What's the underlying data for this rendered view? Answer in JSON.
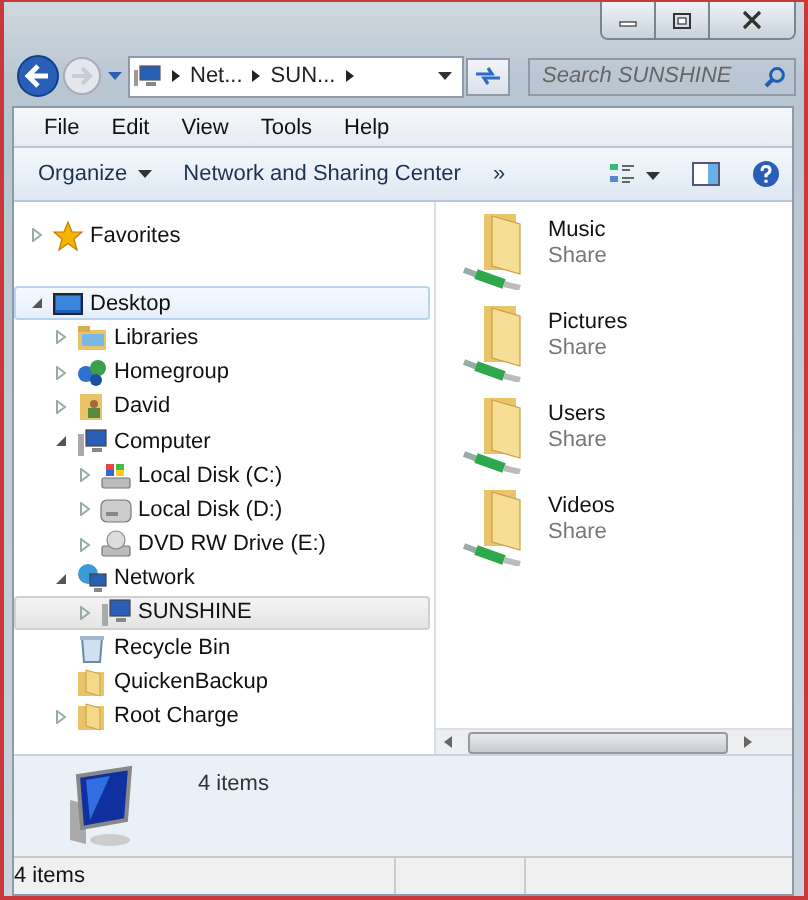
{
  "address": {
    "crumbs": [
      "Net...",
      "SUN..."
    ]
  },
  "search": {
    "placeholder": "Search SUNSHINE"
  },
  "menu": [
    "File",
    "Edit",
    "View",
    "Tools",
    "Help"
  ],
  "commands": [
    {
      "label": "Organize",
      "kind": "dropdown"
    },
    {
      "label": "Network and Sharing Center",
      "kind": "plain"
    },
    {
      "label": "»",
      "kind": "plain"
    }
  ],
  "tree": [
    {
      "label": "Favorites",
      "kind": "star",
      "expanded": false,
      "selected": false,
      "hovered": false
    },
    {
      "label": "Desktop",
      "kind": "desktop",
      "expanded": true,
      "selected": false,
      "hovered": true,
      "children": [
        {
          "label": "Libraries",
          "kind": "library",
          "expanded": false,
          "selected": false,
          "hovered": false
        },
        {
          "label": "Homegroup",
          "kind": "homegroup",
          "expanded": false,
          "selected": false,
          "hovered": false
        },
        {
          "label": "David",
          "kind": "user",
          "expanded": false,
          "selected": false,
          "hovered": false
        },
        {
          "label": "Computer",
          "kind": "computer",
          "expanded": true,
          "selected": false,
          "hovered": false,
          "children": [
            {
              "label": "Local Disk (C:)",
              "kind": "sysdisk",
              "expanded": false,
              "selected": false,
              "hovered": false
            },
            {
              "label": "Local Disk (D:)",
              "kind": "disk",
              "expanded": false,
              "selected": false,
              "hovered": false
            },
            {
              "label": "DVD RW Drive (E:)",
              "kind": "dvd",
              "expanded": false,
              "selected": false,
              "hovered": false
            }
          ]
        },
        {
          "label": "Network",
          "kind": "network",
          "expanded": true,
          "selected": false,
          "hovered": false,
          "children": [
            {
              "label": "SUNSHINE",
              "kind": "computer",
              "expanded": false,
              "selected": true,
              "hovered": false
            }
          ]
        },
        {
          "label": "Recycle Bin",
          "kind": "recycle",
          "selected": false,
          "hovered": false
        },
        {
          "label": "QuickenBackup",
          "kind": "folder",
          "selected": false,
          "hovered": false
        },
        {
          "label": "Root Charge",
          "kind": "folder",
          "expanded": false,
          "selected": false,
          "hovered": false
        }
      ]
    }
  ],
  "items": [
    {
      "name": "Music",
      "type": "Share"
    },
    {
      "name": "Pictures",
      "type": "Share"
    },
    {
      "name": "Users",
      "type": "Share"
    },
    {
      "name": "Videos",
      "type": "Share"
    }
  ],
  "details": {
    "text": "4 items"
  },
  "status_bar": {
    "text": "4 items"
  }
}
